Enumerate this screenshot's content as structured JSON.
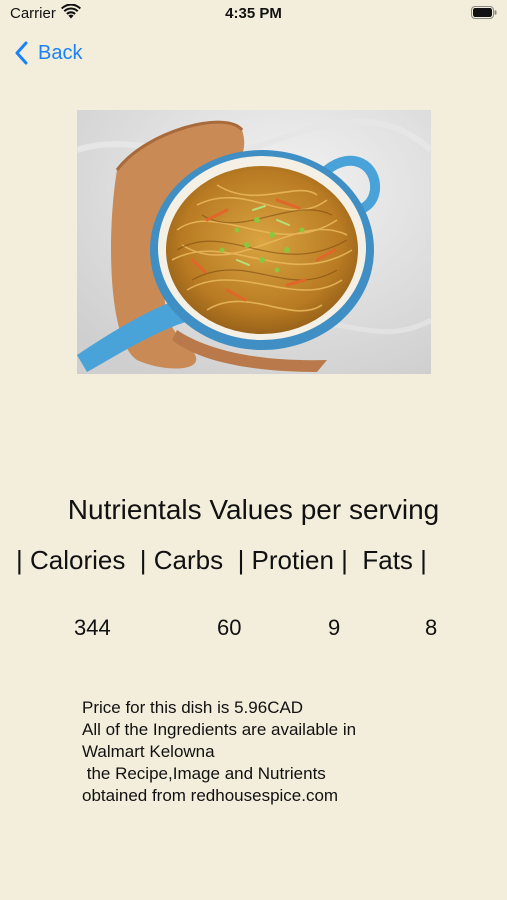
{
  "status_bar": {
    "carrier": "Carrier",
    "time": "4:35 PM"
  },
  "nav": {
    "back_label": "Back"
  },
  "image": {
    "icon": "noodle-dish-photo"
  },
  "nutrition": {
    "heading": "Nutrientals Values per serving",
    "header_row": "| Calories  | Carbs  | Protien |  Fats |",
    "values": {
      "calories": "344",
      "carbs": "60",
      "protein": "9",
      "fats": "8"
    }
  },
  "info": {
    "line1": "Price for this dish is 5.96CAD",
    "line2": "All of the Ingredients are available in",
    "line3": "Walmart Kelowna",
    "line4": " the Recipe,Image and Nutrients",
    "line5": "obtained from redhousespice.com"
  },
  "colors": {
    "background": "#f3eedc",
    "accent": "#1a82f6"
  }
}
